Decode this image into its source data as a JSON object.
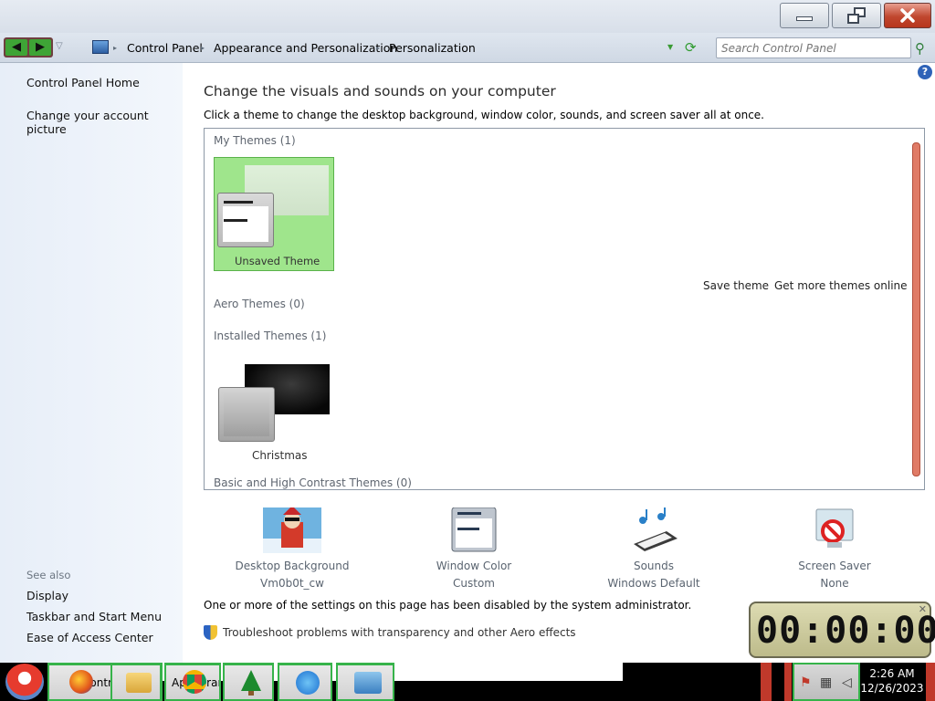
{
  "window": {
    "minimize_label": "Minimize",
    "maximize_label": "Restore Down",
    "close_label": "Close"
  },
  "address_bar": {
    "back_icon": "back-arrow",
    "forward_icon": "forward-arrow",
    "breadcrumbs": [
      "Control Panel",
      "Appearance and Personalization",
      "Personalization"
    ],
    "search_placeholder": "Search Control Panel"
  },
  "left_pane": {
    "links": [
      "Control Panel Home",
      "Change your account picture"
    ],
    "see_also_title": "See also",
    "see_also_links": [
      "Display",
      "Taskbar and Start Menu",
      "Ease of Access Center"
    ]
  },
  "main": {
    "title": "Change the visuals and sounds on your computer",
    "instructions": "Click a theme to change the desktop background, window color, sounds, and screen saver all at once.",
    "help_icon": "?",
    "theme_groups": [
      {
        "title": "My Themes (1)"
      },
      {
        "title": "Aero Themes (0)"
      },
      {
        "title": "Installed Themes (1)"
      },
      {
        "title": "Basic and High Contrast Themes (0)"
      }
    ],
    "my_themes": [
      {
        "name": "Unsaved Theme",
        "selected": true
      }
    ],
    "installed_themes": [
      {
        "name": "Christmas"
      }
    ],
    "panel_links": {
      "save": "Save theme",
      "more": "Get more themes online"
    },
    "customizations": [
      {
        "label": "Desktop Background",
        "value": "Vm0b0t_cw",
        "icon": "desktop-background-icon"
      },
      {
        "label": "Window Color",
        "value": "Custom",
        "icon": "window-color-icon"
      },
      {
        "label": "Sounds",
        "value": "Windows Default",
        "icon": "sounds-icon"
      },
      {
        "label": "Screen Saver",
        "value": "None",
        "icon": "screen-saver-icon"
      }
    ],
    "admin_note": "One or more of the settings on this page has been disabled by the system administrator.",
    "troubleshoot_link": "Troubleshoot problems with transparency and other Aero effects"
  },
  "stopwatch": {
    "display": "00:00:00"
  },
  "taskbar": {
    "buttons": [
      {
        "label": "Control Panel"
      },
      {
        "label": "Appearance"
      }
    ],
    "pinned_apps": [
      "firefox-icon",
      "file-explorer-icon",
      "chrome-icon",
      "christmas-tree-icon",
      "messenger-icon",
      "remote-desktop-icon"
    ],
    "clock_time": "2:26 AM",
    "clock_date": "12/26/2023"
  },
  "colors": {
    "selected_theme_bg": "#9fe58c",
    "scrollbar": "#e07b66",
    "taskbar_accent": "#36b34a"
  }
}
